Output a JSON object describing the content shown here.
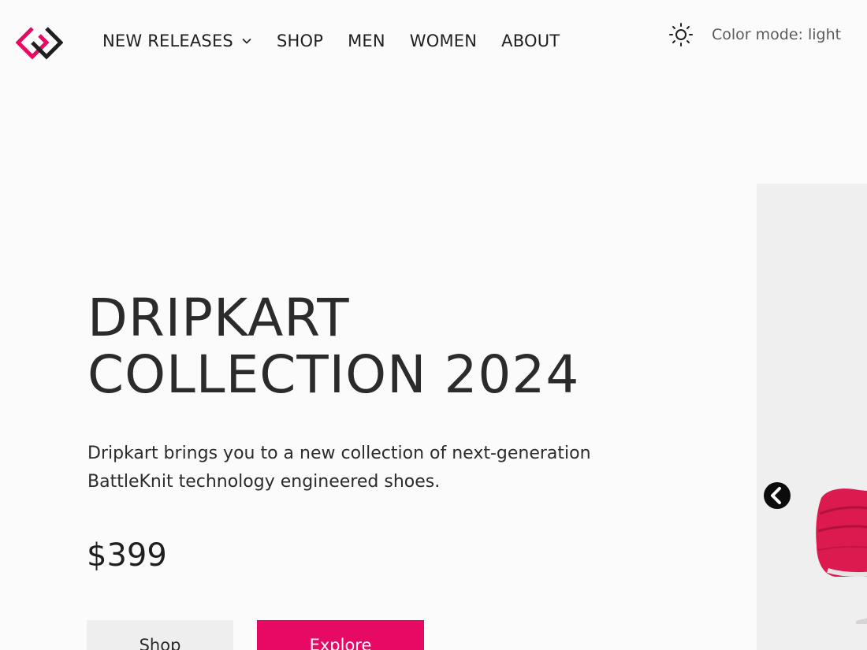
{
  "brand": {
    "logo_icon": "interlocked-diamonds-logo",
    "colors": {
      "primary": "#e60a64",
      "dark": "#1f1f1f"
    }
  },
  "nav": {
    "items": [
      {
        "label": "NEW RELEASES",
        "has_dropdown": true
      },
      {
        "label": "SHOP"
      },
      {
        "label": "MEN"
      },
      {
        "label": "WOMEN"
      },
      {
        "label": "ABOUT"
      }
    ]
  },
  "theme": {
    "icon": "sun-icon",
    "label": "Color mode: light"
  },
  "hero": {
    "title_line1": "DRIPKART",
    "title_line2": "COLLECTION 2024",
    "description": "Dripkart brings you to a new collection of next-generation BattleKnit technology engineered shoes.",
    "price": "$399",
    "shop_label": "Shop",
    "explore_label": "Explore"
  },
  "carousel": {
    "prev_icon": "chevron-left-circle-icon",
    "image": "red-sneaker"
  }
}
